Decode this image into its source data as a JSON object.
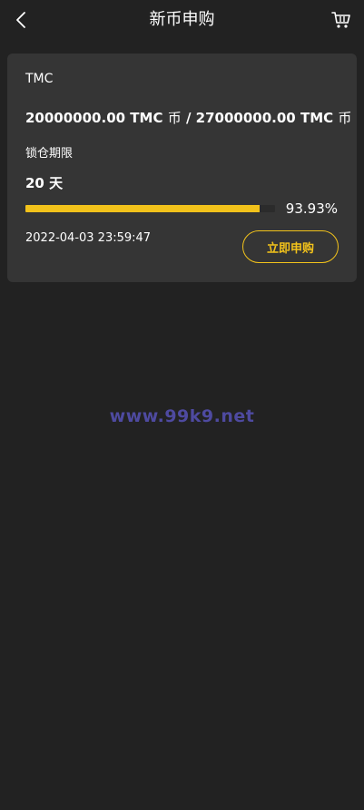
{
  "header": {
    "title": "新币申购",
    "back_icon": "chevron-left-icon",
    "cart_icon": "cart-icon"
  },
  "card": {
    "coin_name": "TMC",
    "amount_sold": "20000000.00 TMC",
    "amount_unit_1": "币",
    "separator": "/",
    "amount_total": "27000000.00 TMC",
    "amount_unit_2": "币",
    "lock_label": "锁仓期限",
    "lock_value": "20 天",
    "progress_fraction": 0.9393,
    "progress_text": "93.93%",
    "end_time": "2022-04-03 23:59:47",
    "subscribe_label": "立即申购"
  },
  "watermark": "www.99k9.net",
  "colors": {
    "background": "#222222",
    "card": "#353535",
    "accent": "#f2c21b",
    "watermark": "#4e4aa0"
  }
}
